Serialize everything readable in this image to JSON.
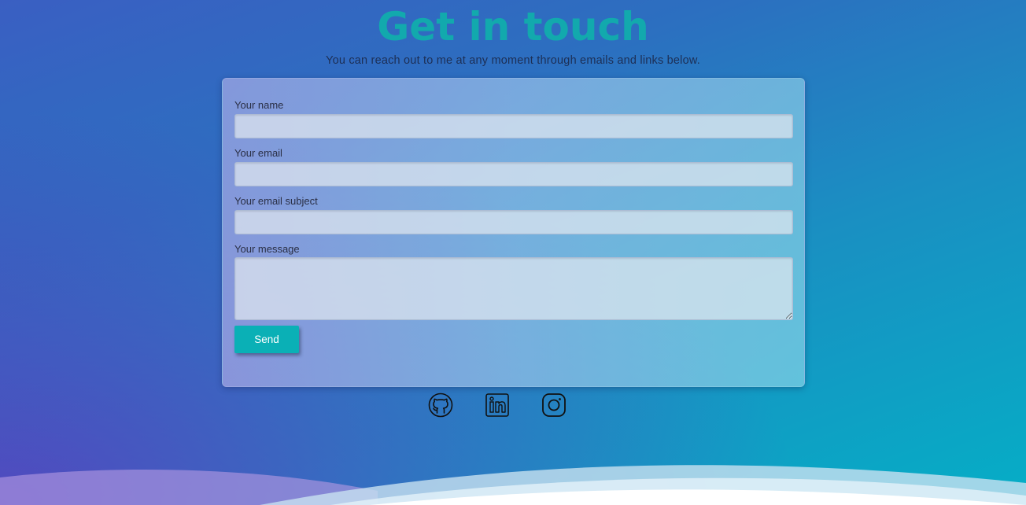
{
  "header": {
    "title": "Get in touch",
    "subtitle": "You can reach out to me at any moment through emails and links below."
  },
  "form": {
    "name_label": "Your name",
    "name_value": "",
    "email_label": "Your email",
    "email_value": "",
    "subject_label": "Your email subject",
    "subject_value": "",
    "message_label": "Your message",
    "message_value": "",
    "send_label": "Send"
  },
  "socials": [
    {
      "icon": "github-icon"
    },
    {
      "icon": "linkedin-icon"
    },
    {
      "icon": "instagram-icon"
    }
  ],
  "colors": {
    "accent": "#0ab0b6",
    "title": "#12a9ad",
    "icon_stroke": "#111111"
  }
}
